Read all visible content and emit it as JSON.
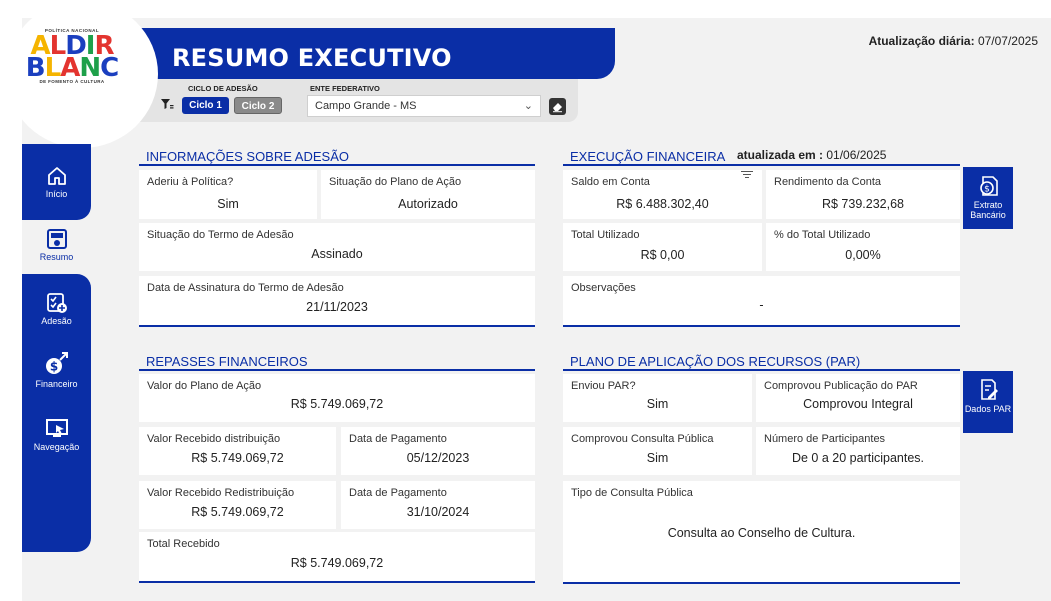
{
  "header": {
    "title": "RESUMO EXECUTIVO",
    "daily_update_label": "Atualização diária:",
    "daily_update_date": "07/07/2025"
  },
  "logo": {
    "top_text": "POLÍTICA NACIONAL",
    "line1": "ALDIR",
    "line2": "BLANC",
    "bottom_text": "DE FOMENTO À CULTURA"
  },
  "filters": {
    "cycle_label": "CICLO DE ADESÃO",
    "cycles": [
      "Ciclo 1",
      "Ciclo 2"
    ],
    "entity_label": "ENTE FEDERATIVO",
    "entity_value": "Campo Grande - MS"
  },
  "nav": {
    "items": [
      {
        "label": "Início",
        "icon": "home-icon"
      },
      {
        "label": "Resumo",
        "icon": "dashboard-icon"
      },
      {
        "label": "Adesão",
        "icon": "checklist-add-icon"
      },
      {
        "label": "Financeiro",
        "icon": "money-growth-icon"
      },
      {
        "label": "Navegação",
        "icon": "monitor-cursor-icon"
      }
    ]
  },
  "adesao": {
    "title": "INFORMAÇÕES SOBRE ADESÃO",
    "aderiu_label": "Aderiu à Política?",
    "aderiu_value": "Sim",
    "situacao_plano_label": "Situação do Plano de Ação",
    "situacao_plano_value": "Autorizado",
    "situacao_termo_label": "Situação do Termo de Adesão",
    "situacao_termo_value": "Assinado",
    "data_assinatura_label": "Data de Assinatura do Termo de Adesão",
    "data_assinatura_value": "21/11/2023"
  },
  "execucao": {
    "title": "EXECUÇÃO FINANCEIRA",
    "updated_label": "atualizada em :",
    "updated_value": "01/06/2025",
    "saldo_label": "Saldo em Conta",
    "saldo_value": "R$ 6.488.302,40",
    "rendimento_label": "Rendimento da Conta",
    "rendimento_value": "R$ 739.232,68",
    "total_utilizado_label": "Total Utilizado",
    "total_utilizado_value": "R$ 0,00",
    "pct_utilizado_label": "% do Total Utilizado",
    "pct_utilizado_value": "0,00%",
    "observacoes_label": "Observações",
    "observacoes_value": "-",
    "extrato_button": "Extrato Bancário"
  },
  "repasses": {
    "title": "REPASSES FINANCEIROS",
    "valor_plano_label": "Valor do Plano de Ação",
    "valor_plano_value": "R$ 5.749.069,72",
    "recebido_dist_label": "Valor Recebido distribuição",
    "recebido_dist_value": "R$ 5.749.069,72",
    "data_pag1_label": "Data de Pagamento",
    "data_pag1_value": "05/12/2023",
    "recebido_redist_label": "Valor Recebido Redistribuição",
    "recebido_redist_value": "R$ 5.749.069,72",
    "data_pag2_label": "Data de Pagamento",
    "data_pag2_value": "31/10/2024",
    "total_label": "Total Recebido",
    "total_value": "R$ 5.749.069,72"
  },
  "par": {
    "title": "PLANO DE APLICAÇÃO DOS RECURSOS (PAR)",
    "enviou_label": "Enviou PAR?",
    "enviou_value": "Sim",
    "comprovou_pub_label": "Comprovou Publicação do PAR",
    "comprovou_pub_value": "Comprovou Integral",
    "comprovou_consulta_label": "Comprovou Consulta Pública",
    "comprovou_consulta_value": "Sim",
    "participantes_label": "Número de Participantes",
    "participantes_value": "De 0 a 20 participantes.",
    "tipo_consulta_label": "Tipo de Consulta Pública",
    "tipo_consulta_value": "Consulta ao Conselho de Cultura.",
    "dados_button": "Dados PAR"
  },
  "colors": {
    "primary": "#0a2ea6",
    "background": "#f2f2f2",
    "chip_inactive": "#8a8a8a"
  }
}
